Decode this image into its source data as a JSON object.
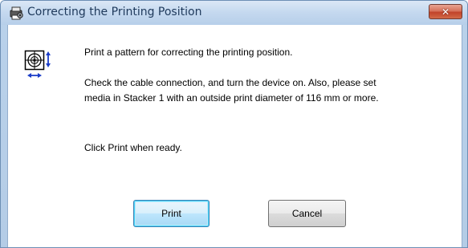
{
  "window": {
    "title": "Correcting the Printing Position",
    "close_glyph": "✕",
    "title_icon": "printer-gear-icon"
  },
  "dialog": {
    "icon": "print-position-target-icon",
    "line1": "Print a pattern for correcting the printing position.",
    "line2": "Check the cable connection, and turn the device on. Also, please set",
    "line3": "media in Stacker 1 with an outside print diameter of 116 mm or more.",
    "line4": "Click Print when ready."
  },
  "buttons": {
    "print_label": "Print",
    "cancel_label": "Cancel"
  },
  "colors": {
    "frame": "#b9d1ea",
    "title_text": "#1e395b",
    "close_button": "#c7523a",
    "default_button_border": "#3c7fb1",
    "icon_accent": "#1a3cc8"
  }
}
